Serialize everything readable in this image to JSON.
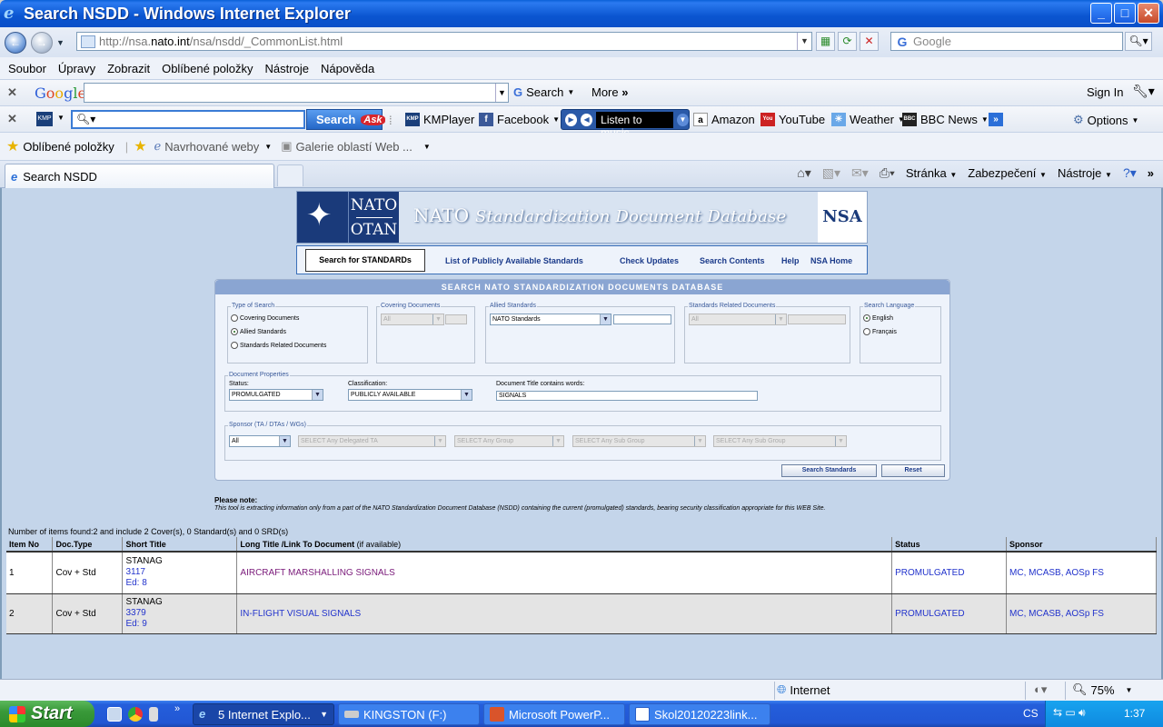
{
  "window": {
    "title": "Search NSDD - Windows Internet Explorer",
    "minimize": "_",
    "maximize": "□",
    "close": "✕"
  },
  "address": {
    "url_prefix": "http://nsa.",
    "url_domain": "nato.int",
    "url_path": "/nsa/nsdd/_CommonList.html",
    "search_placeholder": "Google"
  },
  "menu": [
    "Soubor",
    "Úpravy",
    "Zobrazit",
    "Oblíbené položky",
    "Nástroje",
    "Nápověda"
  ],
  "google_toolbar": {
    "search_label": "Search",
    "more_label": "More",
    "sign_in": "Sign In"
  },
  "ask_toolbar": {
    "search_label": "Search",
    "ask_badge": "Ask",
    "kmplayer": "KMPlayer",
    "facebook": "Facebook",
    "listen": "Listen to music",
    "amazon": "Amazon",
    "youtube": "YouTube",
    "weather": "Weather",
    "bbc": "BBC News",
    "options": "Options"
  },
  "favorites": {
    "label": "Oblíbené položky",
    "suggested": "Navrhované weby",
    "gallery": "Galerie oblastí Web ..."
  },
  "tab": {
    "title": "Search NSDD"
  },
  "command_bar": {
    "page": "Stránka",
    "security": "Zabezpečení",
    "tools": "Nástroje"
  },
  "banner": {
    "nato_top": "NATO",
    "nato_bottom": "OTAN",
    "title_prefix": "NATO ",
    "title_rest": "Standardization Document Database",
    "nsa": "NSA"
  },
  "nav": [
    "Search for STANDARDs",
    "List of Publicly Available Standards",
    "Check Updates",
    "Search Contents",
    "Help",
    "NSA Home"
  ],
  "search_panel": {
    "header": "SEARCH NATO STANDARDIZATION DOCUMENTS DATABASE",
    "type_of_search": {
      "legend": "Type of Search",
      "options": [
        "Covering Documents",
        "Allied Standards",
        "Standards Related Documents"
      ],
      "selected": 1
    },
    "covering_documents": {
      "legend": "Covering Documents",
      "value": "All"
    },
    "allied_standards": {
      "legend": "Allied Standards",
      "value": "NATO Standards"
    },
    "related_documents": {
      "legend": "Standards Related Documents",
      "value": "All"
    },
    "language": {
      "legend": "Search Language",
      "options": [
        "English",
        "Français"
      ],
      "selected": 0
    },
    "properties": {
      "legend": "Document Properties",
      "status_label": "Status:",
      "status_value": "PROMULGATED",
      "classification_label": "Classification:",
      "classification_value": "PUBLICLY AVAILABLE",
      "title_label": "Document Title contains words:",
      "title_value": "SIGNALS"
    },
    "sponsor": {
      "legend": "Sponsor (TA / DTAs / WGs)",
      "value": "All",
      "delegated": "SELECT Any Delegated TA",
      "group": "SELECT Any Group",
      "subgroup1": "SELECT Any Sub Group",
      "subgroup2": "SELECT Any Sub Group"
    },
    "search_button": "Search Standards",
    "reset_button": "Reset"
  },
  "note": {
    "title": "Please note:",
    "text": "This tool is extracting information only from a part of the NATO Standardization Document Database (NSDD) containing the current (promulgated) standards, bearing security classification appropriate for this WEB Site."
  },
  "results": {
    "count_text": "Number of items found:2 and include 2 Cover(s), 0 Standard(s) and 0 SRD(s)",
    "headers": {
      "item": "Item No",
      "type": "Doc.Type",
      "short": "Short Title",
      "long": "Long Title /Link To Document",
      "long_note": "(if available)",
      "status": "Status",
      "sponsor": "Sponsor"
    },
    "rows": [
      {
        "item": "1",
        "type": "Cov + Std",
        "stanag": "STANAG",
        "number": "3117",
        "ed": "Ed: 8",
        "long": "AIRCRAFT MARSHALLING SIGNALS",
        "status": "PROMULGATED",
        "sponsor": "MC, MCASB, AOSp FS"
      },
      {
        "item": "2",
        "type": "Cov + Std",
        "stanag": "STANAG",
        "number": "3379",
        "ed": "Ed: 9",
        "long": "IN-FLIGHT VISUAL SIGNALS",
        "status": "PROMULGATED",
        "sponsor": "MC, MCASB, AOSp FS"
      }
    ]
  },
  "statusbar": {
    "zone": "Internet",
    "zoom": "75%"
  },
  "taskbar": {
    "start": "Start",
    "tasks": [
      "5 Internet Explo...",
      "KINGSTON (F:)",
      "Microsoft PowerP...",
      "Skol20120223link..."
    ],
    "lang": "CS",
    "time": "1:37"
  }
}
